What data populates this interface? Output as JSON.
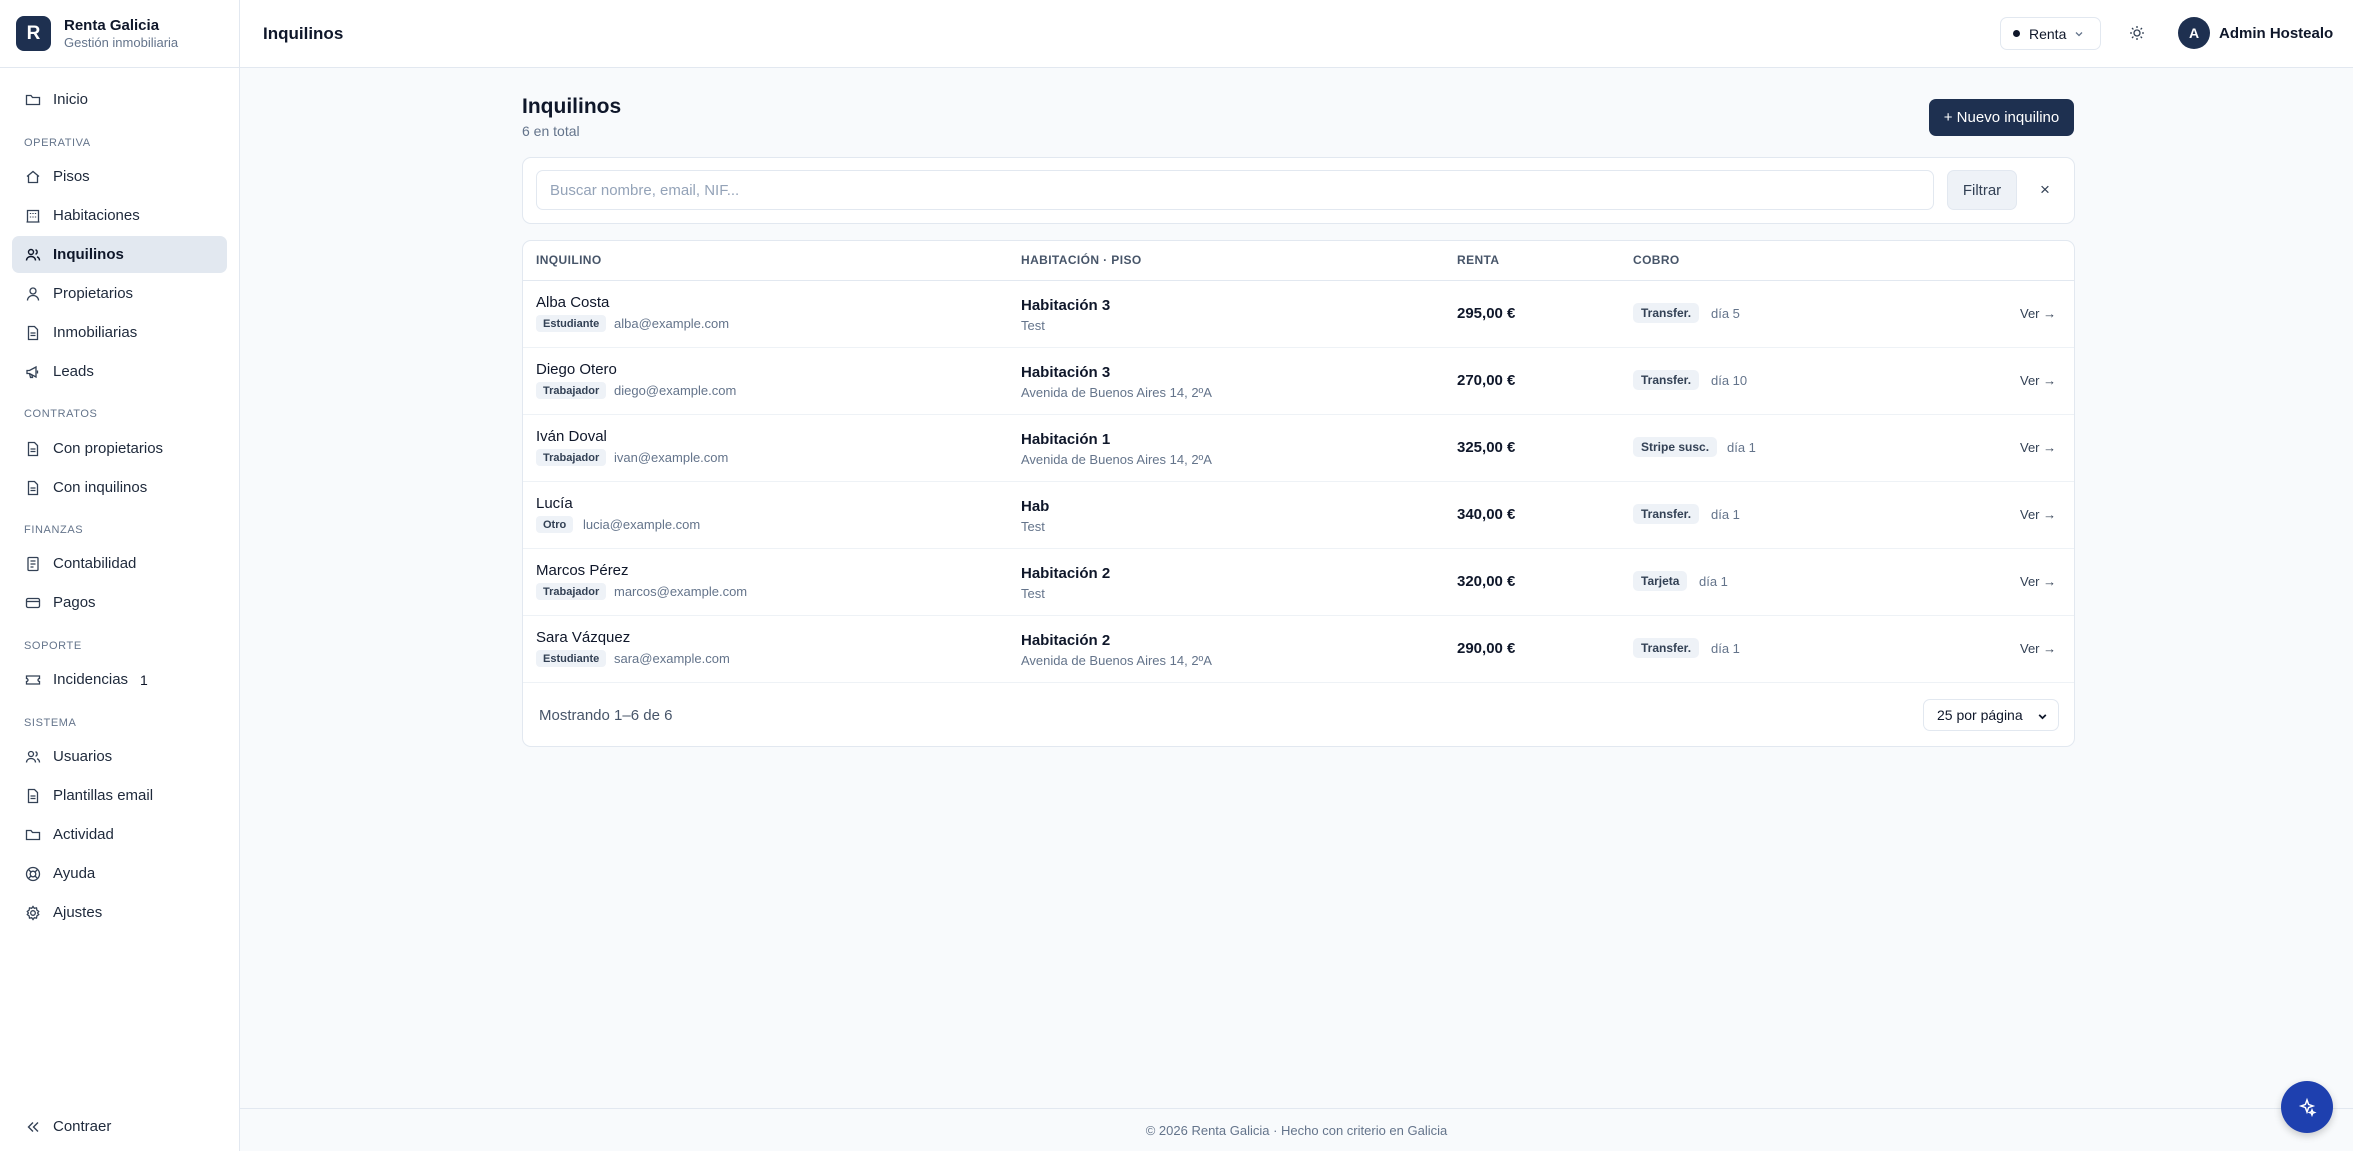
{
  "brand": {
    "initial": "R",
    "name": "Renta Galicia",
    "subtitle": "Gestión inmobiliaria"
  },
  "sidebar": {
    "home": "Inicio",
    "sections": [
      "OPERATIVA",
      "CONTRATOS",
      "FINANZAS",
      "SOPORTE",
      "SISTEMA"
    ],
    "operativa": [
      "Pisos",
      "Habitaciones",
      "Inquilinos",
      "Propietarios",
      "Inmobiliarias",
      "Leads"
    ],
    "contratos": [
      "Con propietarios",
      "Con inquilinos"
    ],
    "finanzas": [
      "Contabilidad",
      "Pagos"
    ],
    "soporte": {
      "label": "Incidencias",
      "count": "1"
    },
    "sistema": [
      "Usuarios",
      "Plantillas email",
      "Actividad",
      "Ayuda",
      "Ajustes"
    ],
    "collapse": "Contraer",
    "active": "Inquilinos"
  },
  "topbar": {
    "title": "Inquilinos",
    "mode": "Renta",
    "user_initial": "A",
    "user_name": "Admin Hostealo"
  },
  "page": {
    "title": "Inquilinos",
    "subtitle": "6 en total",
    "new_button": "+ Nuevo inquilino"
  },
  "filter": {
    "placeholder": "Buscar nombre, email, NIF...",
    "value": "",
    "button": "Filtrar",
    "clear": "×"
  },
  "table": {
    "headers": [
      "INQUILINO",
      "HABITACIÓN · PISO",
      "RENTA",
      "COBRO"
    ],
    "rows": [
      {
        "name": "Alba Costa",
        "type": "Estudiante",
        "email": "alba@example.com",
        "room": "Habitación 3",
        "piso": "Test",
        "rent": "295,00 €",
        "method": "Transfer.",
        "day": "día 5",
        "action": "Ver →"
      },
      {
        "name": "Diego Otero",
        "type": "Trabajador",
        "email": "diego@example.com",
        "room": "Habitación 3",
        "piso": "Avenida de Buenos Aires 14, 2ºA",
        "rent": "270,00 €",
        "method": "Transfer.",
        "day": "día 10",
        "action": "Ver →"
      },
      {
        "name": "Iván Doval",
        "type": "Trabajador",
        "email": "ivan@example.com",
        "room": "Habitación 1",
        "piso": "Avenida de Buenos Aires 14, 2ºA",
        "rent": "325,00 €",
        "method": "Stripe susc.",
        "day": "día 1",
        "action": "Ver →"
      },
      {
        "name": "Lucía",
        "type": "Otro",
        "email": "lucia@example.com",
        "room": "Hab",
        "piso": "Test",
        "rent": "340,00 €",
        "method": "Transfer.",
        "day": "día 1",
        "action": "Ver →"
      },
      {
        "name": "Marcos Pérez",
        "type": "Trabajador",
        "email": "marcos@example.com",
        "room": "Habitación 2",
        "piso": "Test",
        "rent": "320,00 €",
        "method": "Tarjeta",
        "day": "día 1",
        "action": "Ver →"
      },
      {
        "name": "Sara Vázquez",
        "type": "Estudiante",
        "email": "sara@example.com",
        "room": "Habitación 2",
        "piso": "Avenida de Buenos Aires 14, 2ºA",
        "rent": "290,00 €",
        "method": "Transfer.",
        "day": "día 1",
        "action": "Ver →"
      }
    ],
    "showing": "Mostrando 1–6 de 6",
    "per_page": "25 por página"
  },
  "footer": "© 2026 Renta Galicia · Hecho con criterio en Galicia"
}
